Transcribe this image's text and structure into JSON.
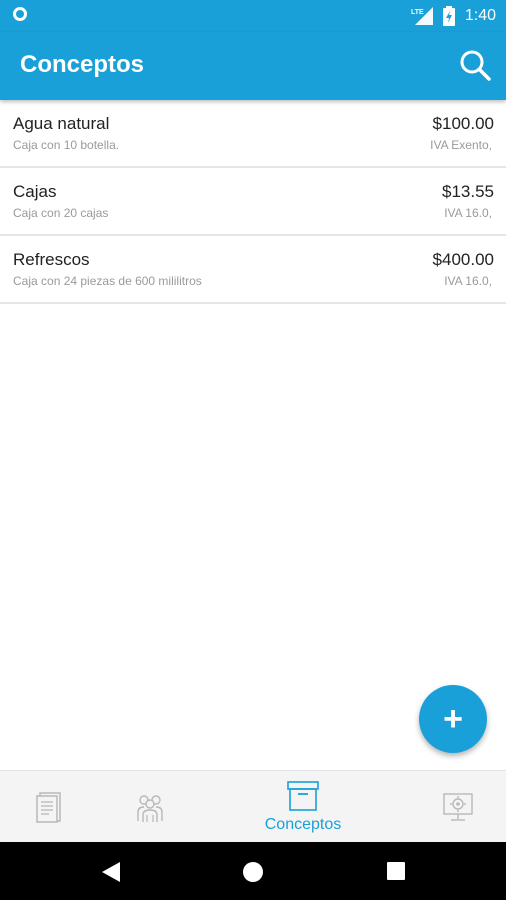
{
  "status_bar": {
    "time": "1:40",
    "network": "LTE"
  },
  "app_bar": {
    "title": "Conceptos",
    "search_icon": "search-icon"
  },
  "items": [
    {
      "name": "Agua natural",
      "description": "Caja con 10 botella.",
      "price": "$100.00",
      "tax": "IVA Exento,"
    },
    {
      "name": "Cajas",
      "description": "Caja con 20 cajas",
      "price": "$13.55",
      "tax": "IVA 16.0,"
    },
    {
      "name": "Refrescos",
      "description": "Caja con 24 piezas de 600 mililitros",
      "price": "$400.00",
      "tax": "IVA 16.0,"
    }
  ],
  "fab": {
    "label": "+"
  },
  "bottom_nav": {
    "items": [
      {
        "icon": "invoice-icon"
      },
      {
        "icon": "clients-icon"
      },
      {
        "icon": "box-icon",
        "label": "Conceptos",
        "active": true
      },
      {
        "icon": "settings-monitor-icon"
      }
    ]
  },
  "colors": {
    "primary": "#1aa0d8",
    "text": "#222222",
    "muted": "#9a9a9a"
  }
}
